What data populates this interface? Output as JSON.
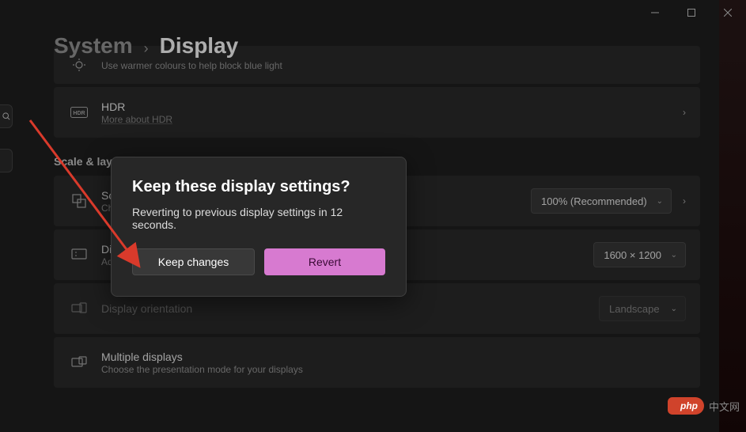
{
  "breadcrumb": {
    "root": "System",
    "current": "Display"
  },
  "rows": {
    "nightlight": {
      "sub": "Use warmer colours to help block blue light"
    },
    "hdr": {
      "title": "HDR",
      "sub": "More about HDR"
    },
    "scale": {
      "title": "Scale",
      "sub": "Change the size of text, apps and other items",
      "value": "100% (Recommended)"
    },
    "resolution": {
      "title": "Display resolution",
      "sub": "Adjust the resolution to fit your connected display",
      "value": "1600 × 1200"
    },
    "orientation": {
      "title": "Display orientation",
      "value": "Landscape"
    },
    "multiple": {
      "title": "Multiple displays",
      "sub": "Choose the presentation mode for your displays"
    }
  },
  "section": {
    "scale_layout": "Scale & layout"
  },
  "dialog": {
    "title": "Keep these display settings?",
    "text": "Reverting to previous display settings in 12 seconds.",
    "keep": "Keep changes",
    "revert": "Revert"
  },
  "watermark": {
    "badge": "php",
    "text": "中文网"
  }
}
